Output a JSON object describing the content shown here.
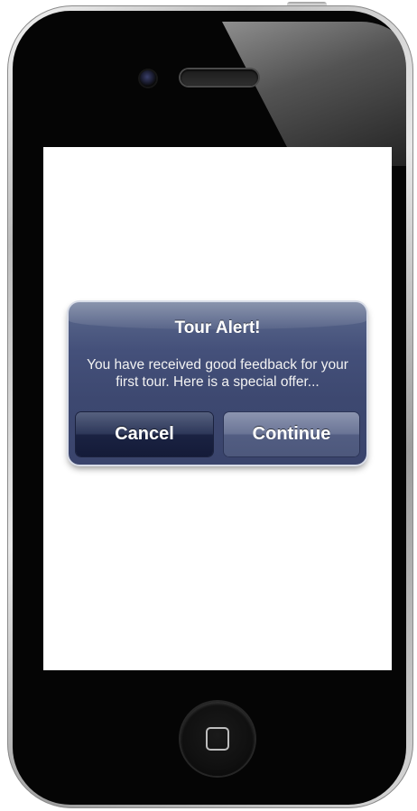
{
  "device": {
    "model": "iPhone",
    "icons": {
      "camera": "front-camera-icon",
      "speaker": "earpiece-speaker-icon",
      "home": "home-button-icon"
    }
  },
  "alert": {
    "title": "Tour Alert!",
    "message": "You have received good feedback for your first tour. Here is a special offer...",
    "buttons": {
      "cancel_label": "Cancel",
      "continue_label": "Continue"
    },
    "colors": {
      "background": "#3d4870",
      "cancel_button": "#1a2242",
      "continue_button": "#6b7596",
      "text": "#ffffff"
    }
  },
  "screen": {
    "background": "#ffffff"
  }
}
